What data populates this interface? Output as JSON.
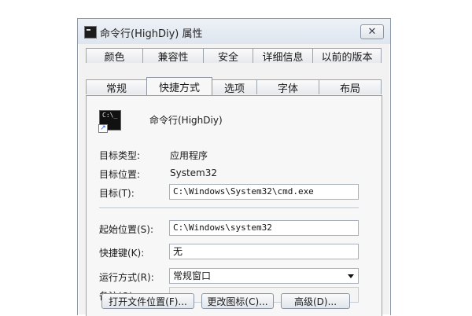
{
  "window": {
    "title": "命令行(HighDiy) 属性",
    "close_symbol": "✕"
  },
  "tabs_top": [
    "颜色",
    "兼容性",
    "安全",
    "详细信息",
    "以前的版本"
  ],
  "tabs_bottom": [
    "常规",
    "快捷方式",
    "选项",
    "字体",
    "布局"
  ],
  "active_tab": "快捷方式",
  "shortcut": {
    "icon": "cmd-console-icon",
    "icon_text": "C:\\_",
    "name": "命令行(HighDiy)",
    "target_type_label": "目标类型:",
    "target_type_value": "应用程序",
    "target_location_label": "目标位置:",
    "target_location_value": "System32",
    "target_label": "目标(T):",
    "target_value": "C:\\Windows\\System32\\cmd.exe",
    "start_in_label": "起始位置(S):",
    "start_in_value": "C:\\Windows\\system32",
    "shortcut_key_label": "快捷键(K):",
    "shortcut_key_value": "无",
    "run_label": "运行方式(R):",
    "run_value": "常规窗口",
    "comment_label": "备注(O):",
    "comment_value": ""
  },
  "buttons": {
    "open_location": "打开文件位置(F)...",
    "change_icon": "更改图标(C)...",
    "advanced": "高级(D)..."
  }
}
